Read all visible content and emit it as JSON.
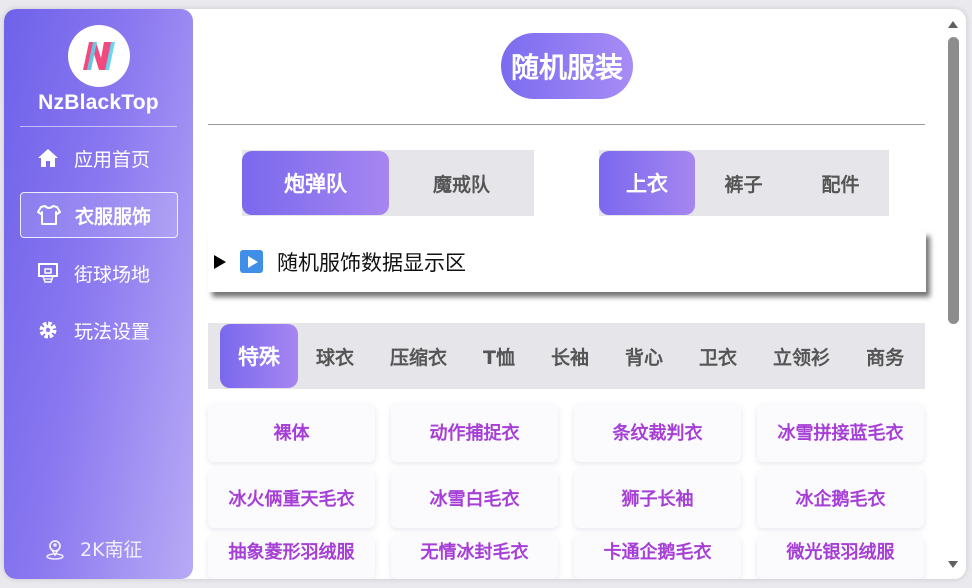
{
  "sidebar": {
    "brand": "NzBlackTop",
    "items": [
      {
        "label": "应用首页",
        "icon": "home-icon"
      },
      {
        "label": "衣服服饰",
        "icon": "shirt-icon"
      },
      {
        "label": "街球场地",
        "icon": "basketball-hoop-icon"
      },
      {
        "label": "玩法设置",
        "icon": "gear-icon"
      }
    ],
    "footer": "2K南征"
  },
  "main": {
    "title": "随机服装",
    "team_seg": [
      "炮弹队",
      "魔戒队"
    ],
    "part_seg": [
      "上衣",
      "裤子",
      "配件"
    ],
    "display_label": "随机服饰数据显示区",
    "categories": [
      "特殊",
      "球衣",
      "压缩衣",
      "T恤",
      "长袖",
      "背心",
      "卫衣",
      "立领衫",
      "商务"
    ],
    "items": [
      "裸体",
      "动作捕捉衣",
      "条纹裁判衣",
      "冰雪拼接蓝毛衣",
      "冰火俩重天毛衣",
      "冰雪白毛衣",
      "狮子长袖",
      "冰企鹅毛衣",
      "抽象菱形羽绒服",
      "无情冰封毛衣",
      "卡通企鹅毛衣",
      "微光银羽绒服"
    ]
  },
  "colors": {
    "accent_start": "#7a68ee",
    "accent_end": "#a686f0",
    "item_text": "#a63fd6"
  }
}
